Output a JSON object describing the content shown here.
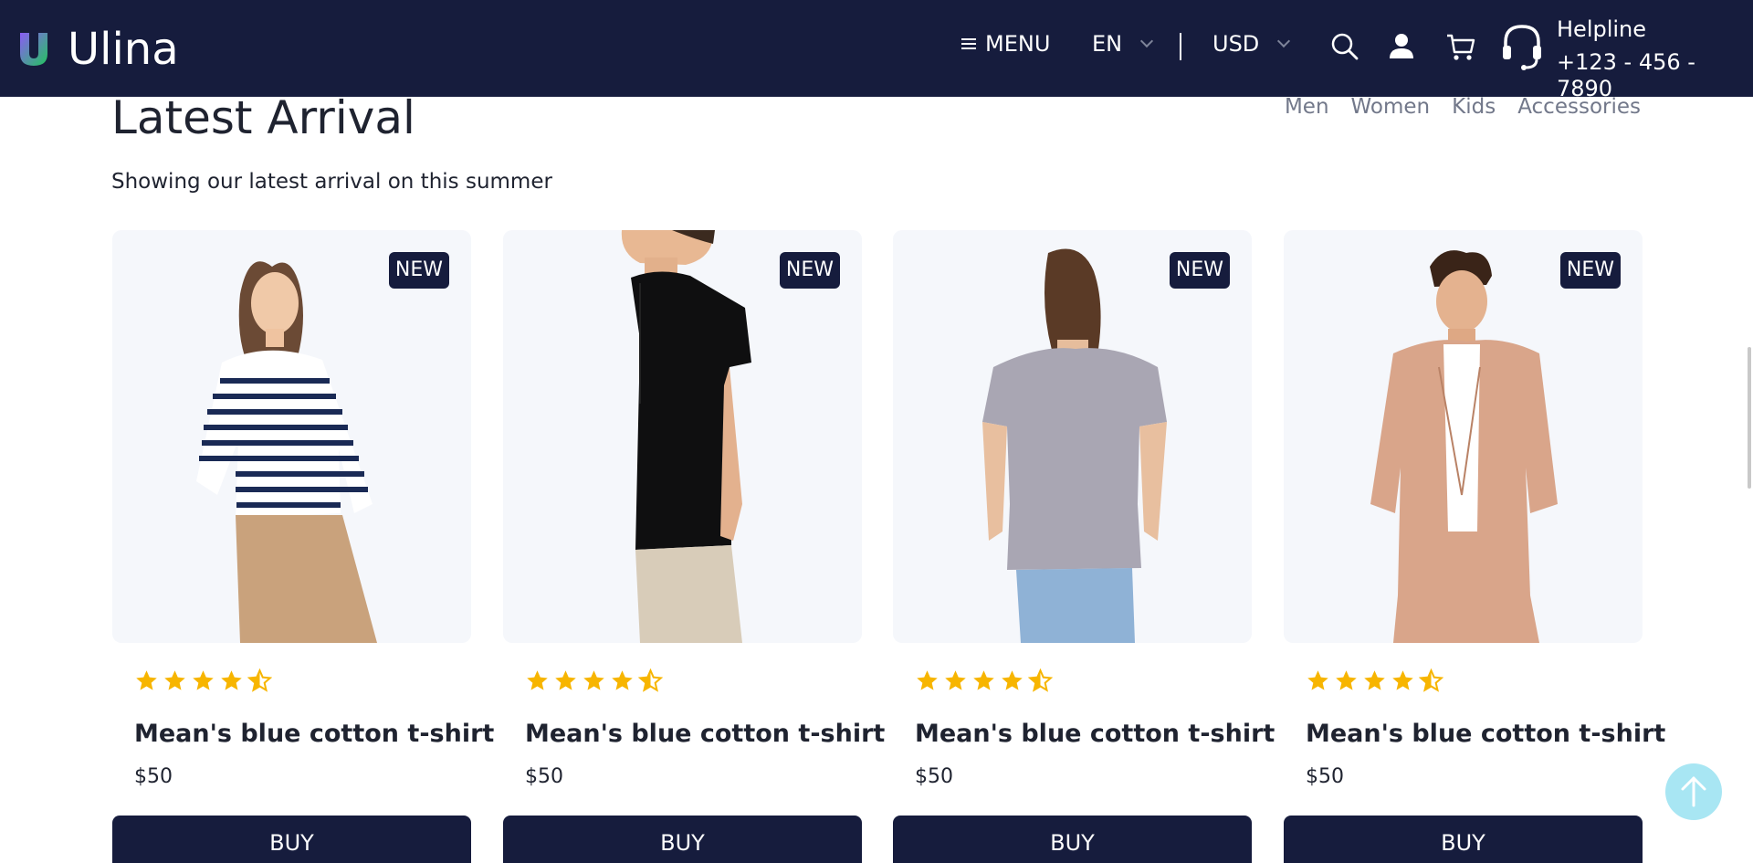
{
  "header": {
    "brand": "Ulina",
    "menu_label": "MENU",
    "language": "EN",
    "currency": "USD",
    "helpline_label": "Helpline",
    "helpline_number": "+123 - 456 - 7890",
    "icons": [
      "menu-icon",
      "search-icon",
      "user-icon",
      "cart-icon",
      "headset-icon"
    ]
  },
  "section": {
    "title": "Latest Arrival",
    "subtitle": "Showing our latest arrival on this summer",
    "tabs": [
      "Men",
      "Women",
      "Kids",
      "Accessories"
    ]
  },
  "products": [
    {
      "badge": "NEW",
      "name": "Mean's blue cotton t-shirt",
      "price": "$50",
      "rating": 4.5,
      "button": "BUY"
    },
    {
      "badge": "NEW",
      "name": "Mean's blue cotton t-shirt",
      "price": "$50",
      "rating": 4.5,
      "button": "BUY"
    },
    {
      "badge": "NEW",
      "name": "Mean's blue cotton t-shirt",
      "price": "$50",
      "rating": 4.5,
      "button": "BUY"
    },
    {
      "badge": "NEW",
      "name": "Mean's blue cotton t-shirt",
      "price": "$50",
      "rating": 4.5,
      "button": "BUY"
    }
  ],
  "colors": {
    "navy": "#161c3d",
    "star": "#f7b500",
    "card_bg": "#f5f7fb",
    "scroll_top": "#a8e6f3"
  }
}
